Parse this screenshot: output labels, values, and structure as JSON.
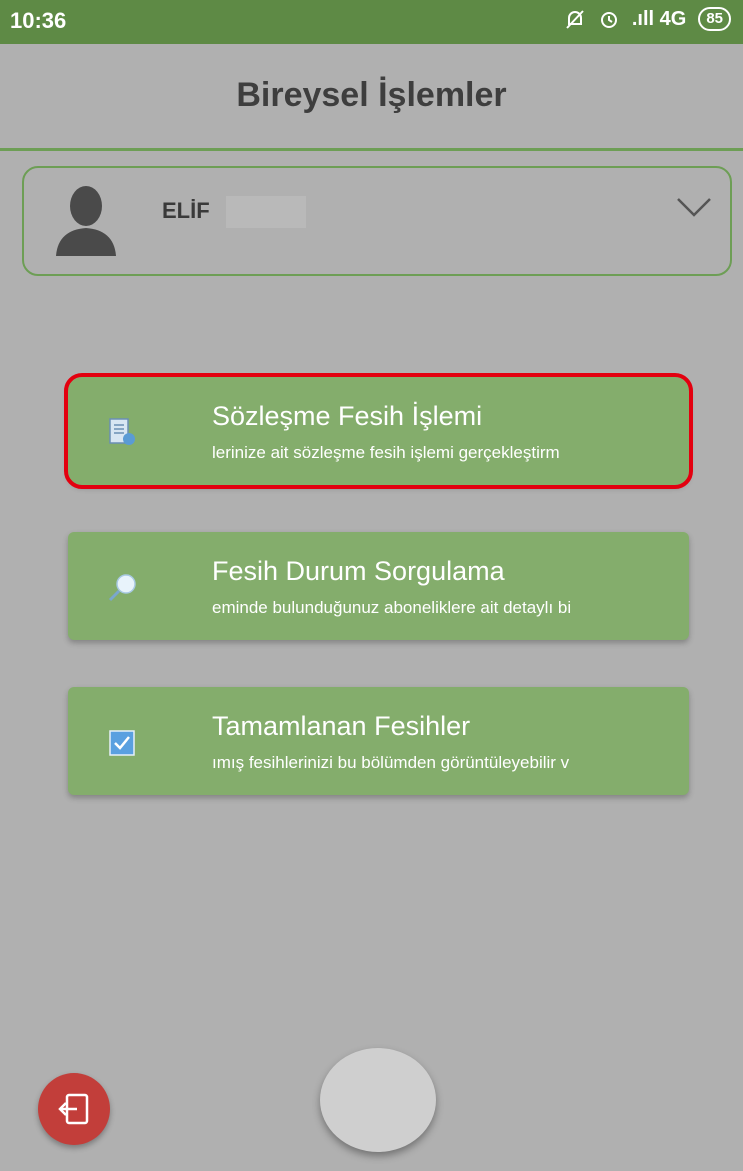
{
  "status_bar": {
    "time": "10:36",
    "network": ".ıll 4G",
    "battery": "85"
  },
  "header": {
    "title": "Bireysel İşlemler"
  },
  "user": {
    "name": "ELİF"
  },
  "menu": [
    {
      "title": "Sözleşme Fesih İşlemi",
      "subtitle": "lerinize ait sözleşme fesih işlemi gerçekleştirm",
      "icon": "document-icon"
    },
    {
      "title": "Fesih Durum Sorgulama",
      "subtitle": "eminde bulunduğunuz aboneliklere ait detaylı bi",
      "icon": "search-icon"
    },
    {
      "title": "Tamamlanan Fesihler",
      "subtitle": "ımış fesihlerinizi bu bölümden görüntüleyebilir v",
      "icon": "checkbox-icon"
    }
  ],
  "colors": {
    "green": "#5e8a45",
    "button": "#84ad6c",
    "highlight": "#e3000f",
    "logout": "#c23e3a"
  }
}
